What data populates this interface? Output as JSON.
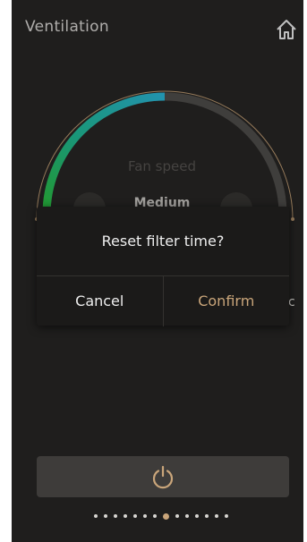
{
  "header": {
    "title": "Ventilation",
    "home_icon": "home-icon"
  },
  "fan": {
    "label": "Fan speed",
    "value": "Medium",
    "level_fraction": 0.5,
    "colors": {
      "track": "#555350",
      "gradient_start": "#2ecc40",
      "gradient_end": "#2ec4e8",
      "outer_ring": "#c9a57a"
    }
  },
  "dialog": {
    "message": "Reset filter time?",
    "cancel_label": "Cancel",
    "confirm_label": "Confirm"
  },
  "side_peek": "с",
  "power": {
    "icon": "power-icon",
    "color": "#c9a57a"
  },
  "pager": {
    "total": 14,
    "active_index": 7
  },
  "colors": {
    "background": "#2a2827",
    "accent": "#c9a57a",
    "dialog_bg": "#1b1a19"
  }
}
